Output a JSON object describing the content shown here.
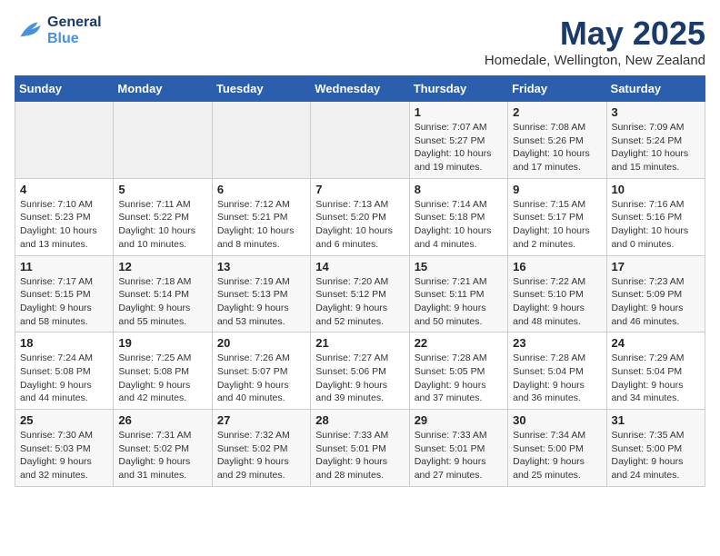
{
  "header": {
    "logo_line1": "General",
    "logo_line2": "Blue",
    "month": "May 2025",
    "location": "Homedale, Wellington, New Zealand"
  },
  "weekdays": [
    "Sunday",
    "Monday",
    "Tuesday",
    "Wednesday",
    "Thursday",
    "Friday",
    "Saturday"
  ],
  "weeks": [
    [
      {
        "day": "",
        "info": ""
      },
      {
        "day": "",
        "info": ""
      },
      {
        "day": "",
        "info": ""
      },
      {
        "day": "",
        "info": ""
      },
      {
        "day": "1",
        "info": "Sunrise: 7:07 AM\nSunset: 5:27 PM\nDaylight: 10 hours\nand 19 minutes."
      },
      {
        "day": "2",
        "info": "Sunrise: 7:08 AM\nSunset: 5:26 PM\nDaylight: 10 hours\nand 17 minutes."
      },
      {
        "day": "3",
        "info": "Sunrise: 7:09 AM\nSunset: 5:24 PM\nDaylight: 10 hours\nand 15 minutes."
      }
    ],
    [
      {
        "day": "4",
        "info": "Sunrise: 7:10 AM\nSunset: 5:23 PM\nDaylight: 10 hours\nand 13 minutes."
      },
      {
        "day": "5",
        "info": "Sunrise: 7:11 AM\nSunset: 5:22 PM\nDaylight: 10 hours\nand 10 minutes."
      },
      {
        "day": "6",
        "info": "Sunrise: 7:12 AM\nSunset: 5:21 PM\nDaylight: 10 hours\nand 8 minutes."
      },
      {
        "day": "7",
        "info": "Sunrise: 7:13 AM\nSunset: 5:20 PM\nDaylight: 10 hours\nand 6 minutes."
      },
      {
        "day": "8",
        "info": "Sunrise: 7:14 AM\nSunset: 5:18 PM\nDaylight: 10 hours\nand 4 minutes."
      },
      {
        "day": "9",
        "info": "Sunrise: 7:15 AM\nSunset: 5:17 PM\nDaylight: 10 hours\nand 2 minutes."
      },
      {
        "day": "10",
        "info": "Sunrise: 7:16 AM\nSunset: 5:16 PM\nDaylight: 10 hours\nand 0 minutes."
      }
    ],
    [
      {
        "day": "11",
        "info": "Sunrise: 7:17 AM\nSunset: 5:15 PM\nDaylight: 9 hours\nand 58 minutes."
      },
      {
        "day": "12",
        "info": "Sunrise: 7:18 AM\nSunset: 5:14 PM\nDaylight: 9 hours\nand 55 minutes."
      },
      {
        "day": "13",
        "info": "Sunrise: 7:19 AM\nSunset: 5:13 PM\nDaylight: 9 hours\nand 53 minutes."
      },
      {
        "day": "14",
        "info": "Sunrise: 7:20 AM\nSunset: 5:12 PM\nDaylight: 9 hours\nand 52 minutes."
      },
      {
        "day": "15",
        "info": "Sunrise: 7:21 AM\nSunset: 5:11 PM\nDaylight: 9 hours\nand 50 minutes."
      },
      {
        "day": "16",
        "info": "Sunrise: 7:22 AM\nSunset: 5:10 PM\nDaylight: 9 hours\nand 48 minutes."
      },
      {
        "day": "17",
        "info": "Sunrise: 7:23 AM\nSunset: 5:09 PM\nDaylight: 9 hours\nand 46 minutes."
      }
    ],
    [
      {
        "day": "18",
        "info": "Sunrise: 7:24 AM\nSunset: 5:08 PM\nDaylight: 9 hours\nand 44 minutes."
      },
      {
        "day": "19",
        "info": "Sunrise: 7:25 AM\nSunset: 5:08 PM\nDaylight: 9 hours\nand 42 minutes."
      },
      {
        "day": "20",
        "info": "Sunrise: 7:26 AM\nSunset: 5:07 PM\nDaylight: 9 hours\nand 40 minutes."
      },
      {
        "day": "21",
        "info": "Sunrise: 7:27 AM\nSunset: 5:06 PM\nDaylight: 9 hours\nand 39 minutes."
      },
      {
        "day": "22",
        "info": "Sunrise: 7:28 AM\nSunset: 5:05 PM\nDaylight: 9 hours\nand 37 minutes."
      },
      {
        "day": "23",
        "info": "Sunrise: 7:28 AM\nSunset: 5:04 PM\nDaylight: 9 hours\nand 36 minutes."
      },
      {
        "day": "24",
        "info": "Sunrise: 7:29 AM\nSunset: 5:04 PM\nDaylight: 9 hours\nand 34 minutes."
      }
    ],
    [
      {
        "day": "25",
        "info": "Sunrise: 7:30 AM\nSunset: 5:03 PM\nDaylight: 9 hours\nand 32 minutes."
      },
      {
        "day": "26",
        "info": "Sunrise: 7:31 AM\nSunset: 5:02 PM\nDaylight: 9 hours\nand 31 minutes."
      },
      {
        "day": "27",
        "info": "Sunrise: 7:32 AM\nSunset: 5:02 PM\nDaylight: 9 hours\nand 29 minutes."
      },
      {
        "day": "28",
        "info": "Sunrise: 7:33 AM\nSunset: 5:01 PM\nDaylight: 9 hours\nand 28 minutes."
      },
      {
        "day": "29",
        "info": "Sunrise: 7:33 AM\nSunset: 5:01 PM\nDaylight: 9 hours\nand 27 minutes."
      },
      {
        "day": "30",
        "info": "Sunrise: 7:34 AM\nSunset: 5:00 PM\nDaylight: 9 hours\nand 25 minutes."
      },
      {
        "day": "31",
        "info": "Sunrise: 7:35 AM\nSunset: 5:00 PM\nDaylight: 9 hours\nand 24 minutes."
      }
    ]
  ]
}
